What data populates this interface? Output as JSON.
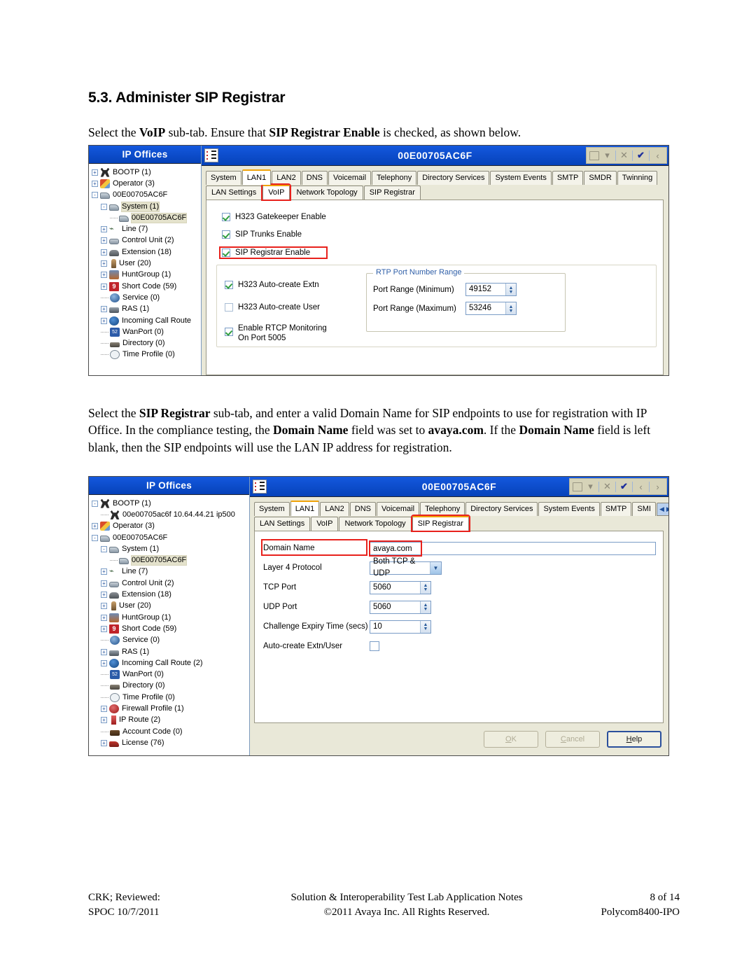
{
  "document": {
    "heading": "5.3. Administer SIP Registrar",
    "paragraph1_parts": [
      {
        "t": "Select the ",
        "b": false
      },
      {
        "t": "VoIP",
        "b": true
      },
      {
        "t": " sub-tab.  Ensure that ",
        "b": false
      },
      {
        "t": "SIP Registrar Enable",
        "b": true
      },
      {
        "t": " is checked, as shown below.",
        "b": false
      }
    ],
    "paragraph2_parts": [
      {
        "t": "Select the ",
        "b": false
      },
      {
        "t": "SIP Registrar",
        "b": true
      },
      {
        "t": " sub-tab, and enter a valid Domain Name for SIP endpoints to use for registration with IP Office.  In the compliance testing, the ",
        "b": false
      },
      {
        "t": "Domain Name",
        "b": true
      },
      {
        "t": " field was set to ",
        "b": false
      },
      {
        "t": "avaya.com",
        "b": true
      },
      {
        "t": ".  If the ",
        "b": false
      },
      {
        "t": "Domain Name",
        "b": true
      },
      {
        "t": " field is left blank, then the SIP endpoints will use the LAN IP address for registration.",
        "b": false
      }
    ]
  },
  "footer": {
    "left_line1": "CRK; Reviewed:",
    "left_line2": "SPOC 10/7/2011",
    "center_line1": "Solution & Interoperability Test Lab Application Notes",
    "center_line2": "©2011 Avaya Inc. All Rights Reserved.",
    "right_line1": "8 of 14",
    "right_line2": "Polycom8400-IPO"
  },
  "shot1": {
    "tree_title": "IP Offices",
    "window_title": "00E00705AC6F",
    "toolbar_icons": [
      "new-icon",
      "dropdown-arrow-icon",
      "close-x-icon",
      "validate-check-icon",
      "prev-arrow-icon"
    ],
    "tree_items": [
      {
        "label": "BOOTP (1)",
        "depth": 0,
        "expander": "+",
        "icon": "bootp-icon",
        "selected": false
      },
      {
        "label": "Operator (3)",
        "depth": 0,
        "expander": "+",
        "icon": "operator-icon",
        "selected": false
      },
      {
        "label": "00E00705AC6F",
        "depth": 0,
        "expander": "-",
        "icon": "system-icon",
        "selected": false
      },
      {
        "label": "System (1)",
        "depth": 1,
        "expander": "-",
        "icon": "system-icon",
        "selected": true
      },
      {
        "label": "00E00705AC6F",
        "depth": 2,
        "expander": "",
        "icon": "system-icon",
        "selected": true
      },
      {
        "label": "Line (7)",
        "depth": 1,
        "expander": "+",
        "icon": "line-icon",
        "selected": false
      },
      {
        "label": "Control Unit (2)",
        "depth": 1,
        "expander": "+",
        "icon": "control-icon",
        "selected": false
      },
      {
        "label": "Extension (18)",
        "depth": 1,
        "expander": "+",
        "icon": "extension-icon",
        "selected": false
      },
      {
        "label": "User (20)",
        "depth": 1,
        "expander": "+",
        "icon": "user-icon",
        "selected": false
      },
      {
        "label": "HuntGroup (1)",
        "depth": 1,
        "expander": "+",
        "icon": "huntgroup-icon",
        "selected": false
      },
      {
        "label": "Short Code (59)",
        "depth": 1,
        "expander": "+",
        "icon": "shortcode-icon",
        "selected": false
      },
      {
        "label": "Service (0)",
        "depth": 1,
        "expander": "",
        "icon": "service-icon",
        "selected": false
      },
      {
        "label": "RAS (1)",
        "depth": 1,
        "expander": "+",
        "icon": "ras-icon",
        "selected": false
      },
      {
        "label": "Incoming Call Route",
        "depth": 1,
        "expander": "+",
        "icon": "callroute-icon",
        "selected": false
      },
      {
        "label": "WanPort (0)",
        "depth": 1,
        "expander": "",
        "icon": "wanport-icon",
        "selected": false
      },
      {
        "label": "Directory (0)",
        "depth": 1,
        "expander": "",
        "icon": "directory-icon",
        "selected": false
      },
      {
        "label": "Time Profile (0)",
        "depth": 1,
        "expander": "",
        "icon": "timeprofile-icon",
        "selected": false
      }
    ],
    "tabs": [
      {
        "label": "System",
        "active": false
      },
      {
        "label": "LAN1",
        "active": true
      },
      {
        "label": "LAN2",
        "active": false
      },
      {
        "label": "DNS",
        "active": false
      },
      {
        "label": "Voicemail",
        "active": false
      },
      {
        "label": "Telephony",
        "active": false
      },
      {
        "label": "Directory Services",
        "active": false
      },
      {
        "label": "System Events",
        "active": false
      },
      {
        "label": "SMTP",
        "active": false
      },
      {
        "label": "SMDR",
        "active": false
      },
      {
        "label": "Twinning",
        "active": false
      }
    ],
    "subtabs": [
      {
        "label": "LAN Settings",
        "active": false,
        "highlight": false
      },
      {
        "label": "VoIP",
        "active": true,
        "highlight": true
      },
      {
        "label": "Network Topology",
        "active": false,
        "highlight": false
      },
      {
        "label": "SIP Registrar",
        "active": false,
        "highlight": false
      }
    ],
    "checkboxes_top": [
      {
        "label": "H323 Gatekeeper Enable",
        "checked": true,
        "highlight": false
      },
      {
        "label": "SIP Trunks Enable",
        "checked": true,
        "highlight": false
      },
      {
        "label": "SIP Registrar Enable",
        "checked": true,
        "highlight": true
      }
    ],
    "checkboxes_group": [
      {
        "label": "H323 Auto-create Extn",
        "checked": true
      },
      {
        "label": "H323 Auto-create User",
        "checked": false
      }
    ],
    "rtcp": {
      "line1": "Enable RTCP Monitoring",
      "line2": "On Port 5005",
      "checked": true
    },
    "rtp_group": {
      "legend": "RTP Port Number Range",
      "rows": [
        {
          "label": "Port Range (Minimum)",
          "value": "49152"
        },
        {
          "label": "Port Range (Maximum)",
          "value": "53246"
        }
      ]
    }
  },
  "shot2": {
    "tree_title": "IP Offices",
    "window_title": "00E00705AC6F",
    "toolbar_icons": [
      "new-icon",
      "dropdown-arrow-icon",
      "close-x-icon",
      "validate-check-icon",
      "prev-arrow-icon",
      "next-arrow-icon"
    ],
    "tree_items": [
      {
        "label": "BOOTP (1)",
        "depth": 0,
        "expander": "-",
        "icon": "bootp-icon",
        "selected": false
      },
      {
        "label": "00e00705ac6f 10.64.44.21 ip500",
        "depth": 1,
        "expander": "",
        "icon": "bootp-icon",
        "selected": false
      },
      {
        "label": "Operator (3)",
        "depth": 0,
        "expander": "+",
        "icon": "operator-icon",
        "selected": false
      },
      {
        "label": "00E00705AC6F",
        "depth": 0,
        "expander": "-",
        "icon": "system-icon",
        "selected": false
      },
      {
        "label": "System (1)",
        "depth": 1,
        "expander": "-",
        "icon": "system-icon",
        "selected": false
      },
      {
        "label": "00E00705AC6F",
        "depth": 2,
        "expander": "",
        "icon": "system-icon",
        "selected": true
      },
      {
        "label": "Line (7)",
        "depth": 1,
        "expander": "+",
        "icon": "line-icon",
        "selected": false
      },
      {
        "label": "Control Unit (2)",
        "depth": 1,
        "expander": "+",
        "icon": "control-icon",
        "selected": false
      },
      {
        "label": "Extension (18)",
        "depth": 1,
        "expander": "+",
        "icon": "extension-icon",
        "selected": false
      },
      {
        "label": "User (20)",
        "depth": 1,
        "expander": "+",
        "icon": "user-icon",
        "selected": false
      },
      {
        "label": "HuntGroup (1)",
        "depth": 1,
        "expander": "+",
        "icon": "huntgroup-icon",
        "selected": false
      },
      {
        "label": "Short Code (59)",
        "depth": 1,
        "expander": "+",
        "icon": "shortcode-icon",
        "selected": false
      },
      {
        "label": "Service (0)",
        "depth": 1,
        "expander": "",
        "icon": "service-icon",
        "selected": false
      },
      {
        "label": "RAS (1)",
        "depth": 1,
        "expander": "+",
        "icon": "ras-icon",
        "selected": false
      },
      {
        "label": "Incoming Call Route (2)",
        "depth": 1,
        "expander": "+",
        "icon": "callroute-icon",
        "selected": false
      },
      {
        "label": "WanPort (0)",
        "depth": 1,
        "expander": "",
        "icon": "wanport-icon",
        "selected": false
      },
      {
        "label": "Directory (0)",
        "depth": 1,
        "expander": "",
        "icon": "directory-icon",
        "selected": false
      },
      {
        "label": "Time Profile (0)",
        "depth": 1,
        "expander": "",
        "icon": "timeprofile-icon",
        "selected": false
      },
      {
        "label": "Firewall Profile (1)",
        "depth": 1,
        "expander": "+",
        "icon": "firewall-icon",
        "selected": false
      },
      {
        "label": "IP Route (2)",
        "depth": 1,
        "expander": "+",
        "icon": "iproute-icon",
        "selected": false
      },
      {
        "label": "Account Code (0)",
        "depth": 1,
        "expander": "",
        "icon": "accountcode-icon",
        "selected": false
      },
      {
        "label": "License (76)",
        "depth": 1,
        "expander": "+",
        "icon": "license-icon",
        "selected": false
      }
    ],
    "tabs": [
      {
        "label": "System",
        "active": false
      },
      {
        "label": "LAN1",
        "active": true
      },
      {
        "label": "LAN2",
        "active": false
      },
      {
        "label": "DNS",
        "active": false
      },
      {
        "label": "Voicemail",
        "active": false
      },
      {
        "label": "Telephony",
        "active": false
      },
      {
        "label": "Directory Services",
        "active": false
      },
      {
        "label": "System Events",
        "active": false
      },
      {
        "label": "SMTP",
        "active": false
      },
      {
        "label": "SMI",
        "active": false
      }
    ],
    "tab_nav": {
      "prev": "◀",
      "next": "▶"
    },
    "subtabs": [
      {
        "label": "LAN Settings",
        "active": false,
        "highlight": false
      },
      {
        "label": "VoIP",
        "active": false,
        "highlight": false
      },
      {
        "label": "Network Topology",
        "active": false,
        "highlight": false
      },
      {
        "label": "SIP Registrar",
        "active": true,
        "highlight": true
      }
    ],
    "fields": [
      {
        "label": "Domain Name",
        "type": "text",
        "value": "avaya.com",
        "highlight": true
      },
      {
        "label": "Layer 4 Protocol",
        "type": "combo",
        "value": "Both TCP & UDP",
        "highlight": false
      },
      {
        "label": "TCP Port",
        "type": "spinner",
        "value": "5060",
        "highlight": false
      },
      {
        "label": "UDP Port",
        "type": "spinner",
        "value": "5060",
        "highlight": false
      },
      {
        "label": "Challenge Expiry Time (secs)",
        "type": "spinner",
        "value": "10",
        "highlight": false
      },
      {
        "label": "Auto-create Extn/User",
        "type": "checkbox",
        "value": "",
        "checked": false,
        "highlight": false
      }
    ],
    "buttons": [
      {
        "label": "OK",
        "mnemonic": "O",
        "primary": false,
        "disabled": true
      },
      {
        "label": "Cancel",
        "mnemonic": "C",
        "primary": false,
        "disabled": true
      },
      {
        "label": "Help",
        "mnemonic": "H",
        "primary": true,
        "disabled": false
      }
    ]
  },
  "colors": {
    "title_blue": "#0a4fd1",
    "tab_accent_orange": "#f0a30a",
    "highlight_red": "#e8211c",
    "panel_beige": "#e9e8d8",
    "check_green": "#2f9e3f"
  }
}
